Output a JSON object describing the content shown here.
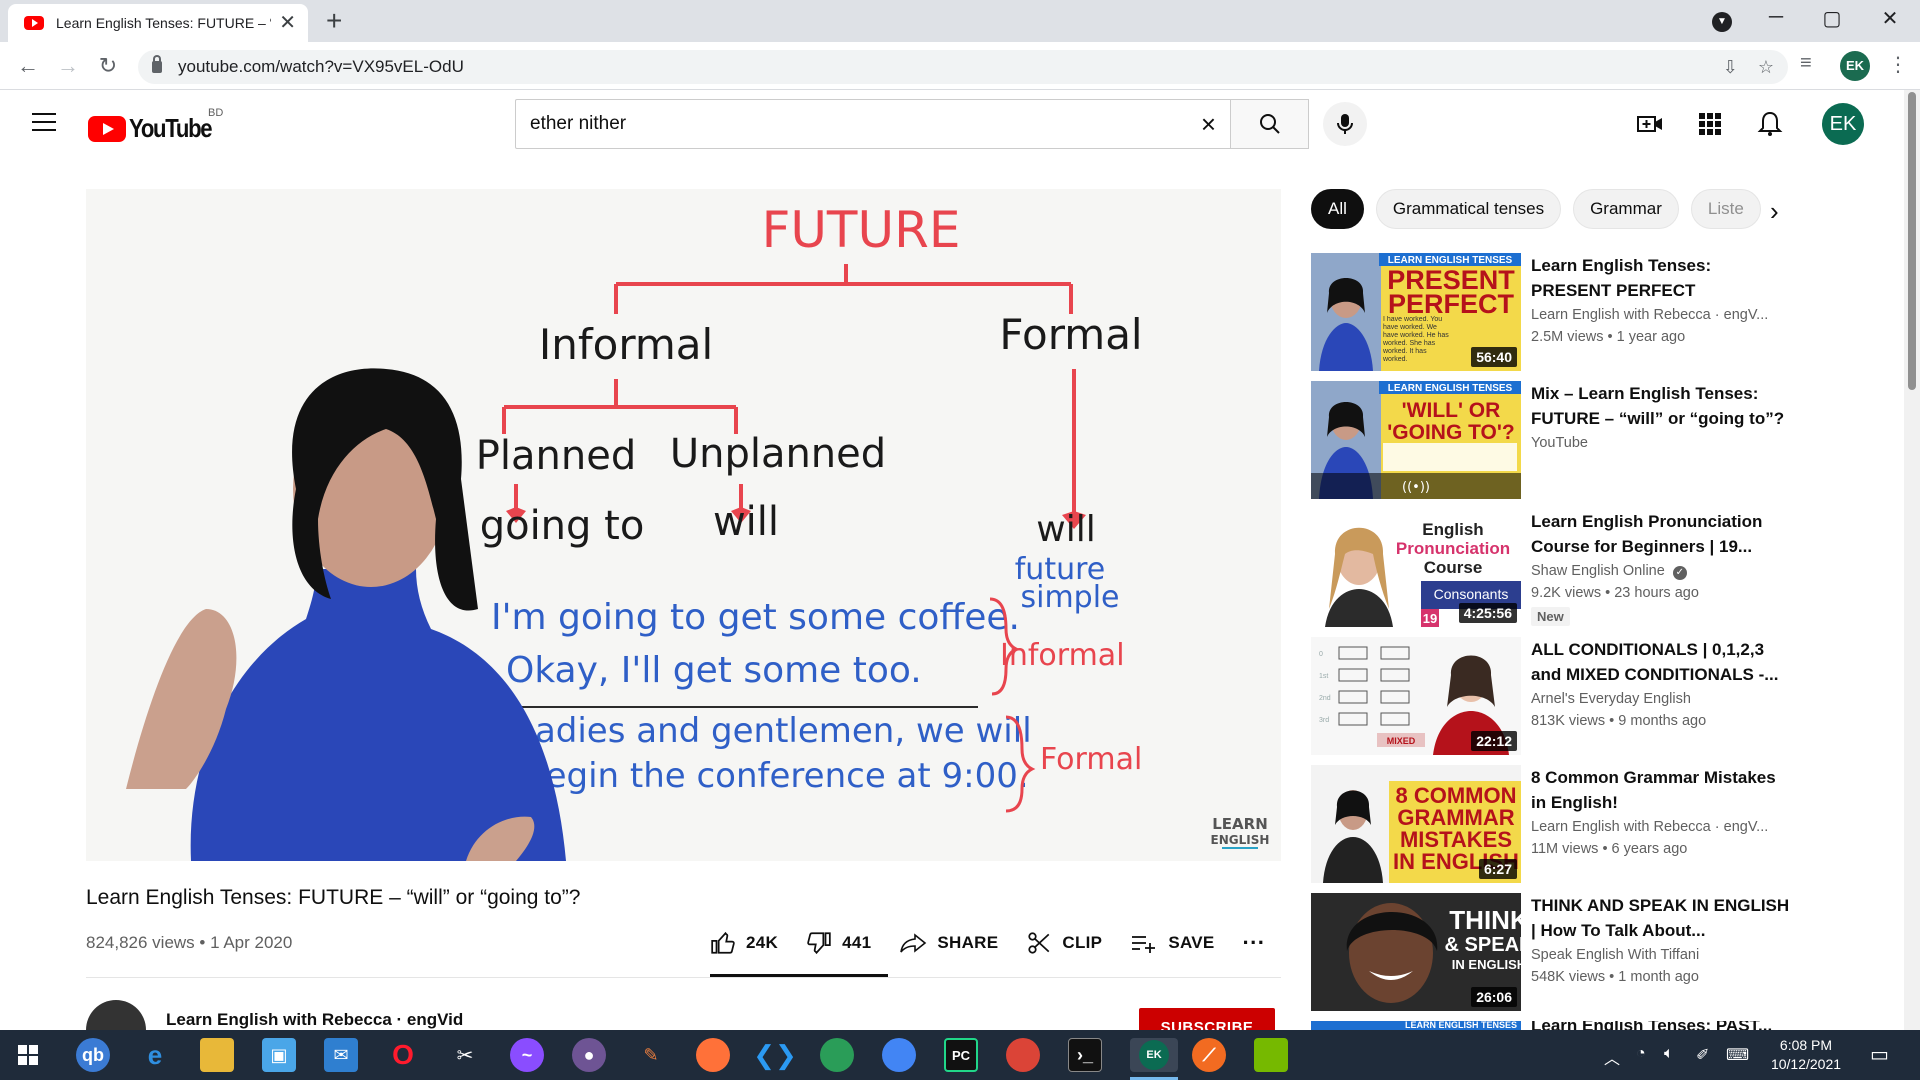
{
  "browser": {
    "tab_title": "Learn English Tenses: FUTURE – “will” or “going to”?",
    "url": "youtube.com/watch?v=VX95vEL-OdU",
    "profile_initials": "EK"
  },
  "masthead": {
    "logo_text": "YouTube",
    "country_code": "BD",
    "search_value": "ether nither",
    "avatar_initials": "EK"
  },
  "whiteboard": {
    "heading": "FUTURE",
    "informal": "Informal",
    "formal": "Formal",
    "planned": "Planned",
    "unplanned": "Unplanned",
    "going_to": "going to",
    "will_left": "will",
    "will_right": "will",
    "future_simple_1": "future",
    "future_simple_2": "simple",
    "example_1": "I'm going to get some coffee.",
    "example_2": "Okay, I'll get some too.",
    "example_3": "Ladies and gentlemen, we will",
    "example_4": "begin the conference at 9:00.",
    "label_informal": "Informal",
    "label_formal": "Formal",
    "watermark_1": "LEARN",
    "watermark_2": "ENGLISH"
  },
  "video": {
    "title": "Learn English Tenses: FUTURE – “will” or “going to”?",
    "views": "824,826 views",
    "date": "1 Apr 2020",
    "likes": "24K",
    "dislikes": "441",
    "share_label": "SHARE",
    "clip_label": "CLIP",
    "save_label": "SAVE",
    "more_label": "···",
    "channel_name": "Learn English with Rebecca · engVid",
    "subscribe_label": "SUBSCRIBE"
  },
  "chips": [
    "All",
    "Grammatical tenses",
    "Grammar",
    "Liste"
  ],
  "recommendations": [
    {
      "title": "Learn English Tenses: PRESENT PERFECT",
      "channel": "Learn English with Rebecca · engV...",
      "meta": "2.5M views • 1 year ago",
      "duration": "56:40",
      "thumb_banner": "LEARN ENGLISH TENSES",
      "thumb_text_1": "PRESENT",
      "thumb_text_2": "PERFECT",
      "thumb_note": "I have worked. You have worked. We have worked. He has worked. She has worked. It has worked."
    },
    {
      "title": "Mix – Learn English Tenses: FUTURE – “will” or “going to”?",
      "channel": "YouTube",
      "meta": "",
      "duration": "",
      "thumb_banner": "LEARN ENGLISH TENSES",
      "thumb_text_1": "'WILL' OR",
      "thumb_text_2": "'GOING TO'?",
      "thumb_note": "((•))"
    },
    {
      "title": "Learn English Pronunciation Course for Beginners | 19...",
      "channel": "Shaw English Online",
      "meta": "9.2K views • 23 hours ago",
      "duration": "4:25:56",
      "badge": "New",
      "thumb_text_1": "English",
      "thumb_text_2": "Pronunciation",
      "thumb_text_3": "Course",
      "thumb_note": "Consonants",
      "thumb_num": "19"
    },
    {
      "title": "ALL CONDITIONALS | 0,1,2,3 and MIXED CONDITIONALS -...",
      "channel": "Arnel's Everyday English",
      "meta": "813K views • 9 months ago",
      "duration": "22:12",
      "thumb_note": "MIXED"
    },
    {
      "title": "8 Common Grammar Mistakes in English!",
      "channel": "Learn English with Rebecca · engV...",
      "meta": "11M views • 6 years ago",
      "duration": "6:27",
      "thumb_text_1": "8 COMMON",
      "thumb_text_2": "GRAMMAR",
      "thumb_text_3": "MISTAKES",
      "thumb_text_4": "IN ENGLISH"
    },
    {
      "title": "THINK AND SPEAK IN ENGLISH | How To Talk About...",
      "channel": "Speak English With Tiffani",
      "meta": "548K views • 1 month ago",
      "duration": "26:06",
      "thumb_text_1": "THINK",
      "thumb_text_2": "& SPEAK",
      "thumb_text_3": "IN ENGLISH"
    }
  ],
  "next_peek": {
    "banner": "LEARN ENGLISH TENSES",
    "title": "Learn English Tenses: PAST..."
  },
  "taskbar": {
    "time": "6:08 PM",
    "date": "10/12/2021",
    "chrome_profile": "EK"
  },
  "colors": {
    "yt_red": "#ff0000",
    "marker_red": "#e8454e",
    "marker_blue": "#2f5fc7",
    "subscribe_red": "#cc0000",
    "taskbar": "#1f2b3a"
  }
}
